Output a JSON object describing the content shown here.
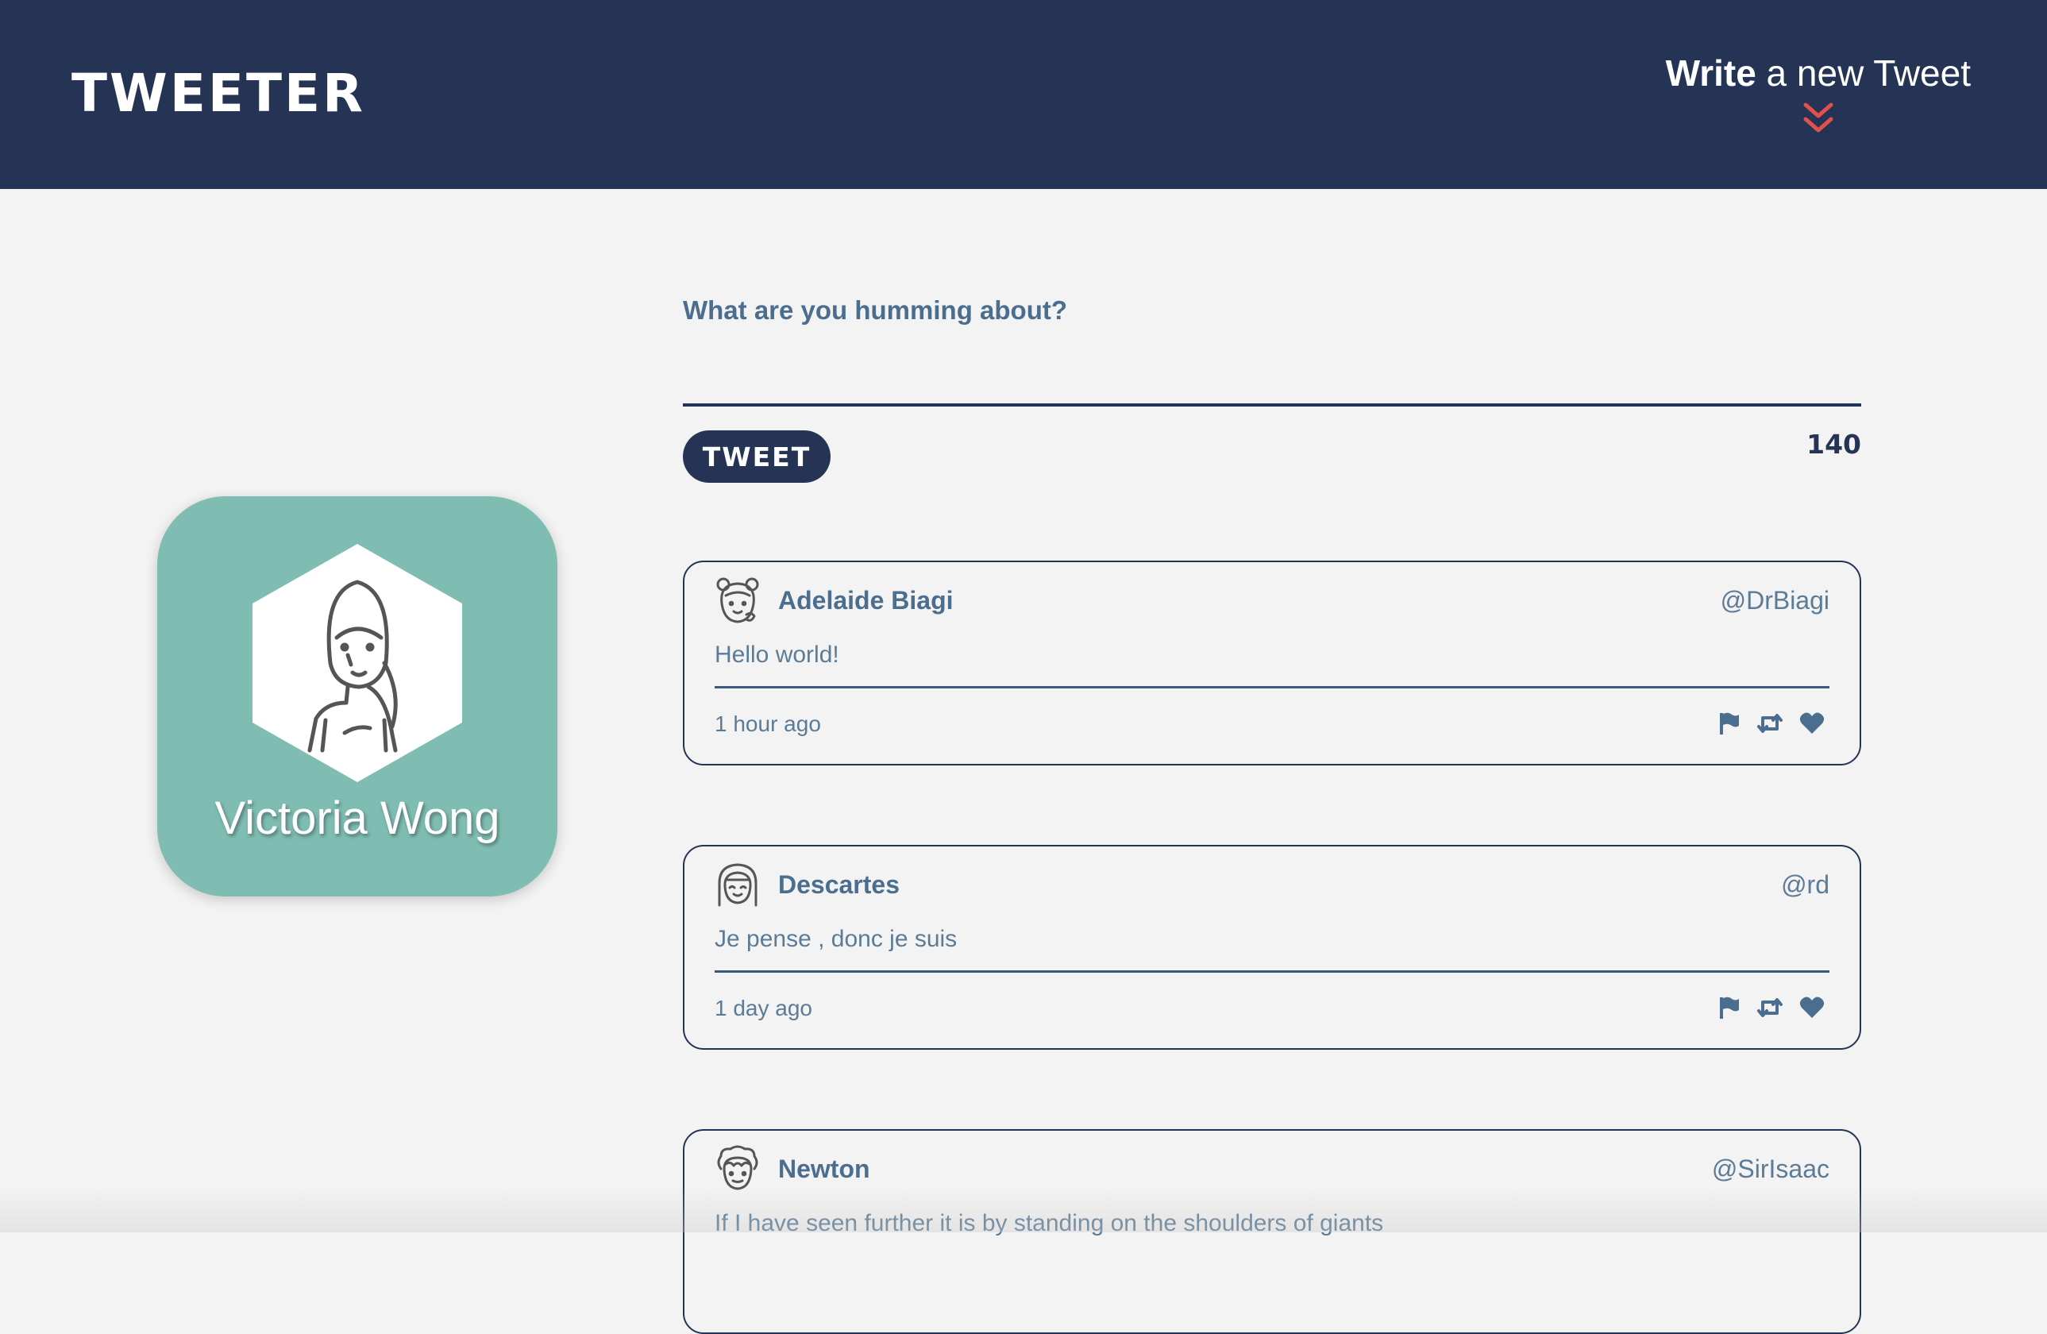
{
  "nav": {
    "logo": "TWEETER",
    "compose_bold": "Write",
    "compose_rest": " a new Tweet",
    "compose_icon": "double-chevron-down-icon",
    "accent_color": "#e2504b",
    "background_color": "#253455"
  },
  "profile": {
    "name": "Victoria Wong",
    "card_color": "#7fbcb2",
    "avatar_icon": "woman-avatar-icon"
  },
  "composer": {
    "prompt": "What are you humming about?",
    "button_label": "TWEET",
    "counter": "140"
  },
  "tweets": [
    {
      "name": "Adelaide Biagi",
      "handle": "@DrBiagi",
      "text": "Hello world!",
      "time": "1 hour ago",
      "avatar_icon": "girl-buns-avatar-icon"
    },
    {
      "name": "Descartes",
      "handle": "@rd",
      "text": "Je pense , donc je suis",
      "time": "1 day ago",
      "avatar_icon": "bob-hair-avatar-icon"
    },
    {
      "name": "Newton",
      "handle": "@SirIsaac",
      "text": "If I have seen further it is by standing on the shoulders of giants",
      "time": "",
      "avatar_icon": "curly-hair-avatar-icon"
    }
  ],
  "actions": [
    "flag-icon",
    "retweet-icon",
    "heart-icon"
  ]
}
